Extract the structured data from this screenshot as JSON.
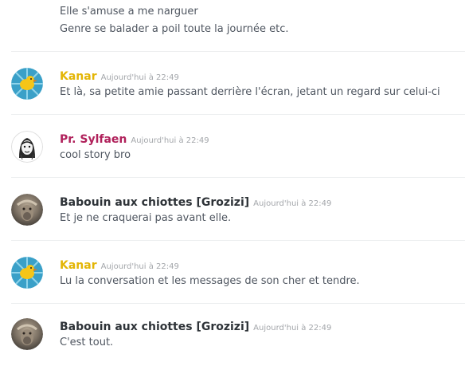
{
  "chat": {
    "continuation_lines": [
      "Elle s'amuse a me narguer",
      "Genre se balader a poil toute la journée etc."
    ],
    "messages": [
      {
        "username": "Kanar",
        "username_color": "#e3b505",
        "avatar_icon": "yellow-duck-sunburst-avatar",
        "timestamp": "Aujourd'hui à 22:49",
        "text": "Et là, sa petite amie passant derrière l'écran, jetant un regard sur celui-ci"
      },
      {
        "username": "Pr. Sylfaen",
        "username_color": "#b0215b",
        "avatar_icon": "sketch-portrait-avatar",
        "timestamp": "Aujourd'hui à 22:49",
        "text": "cool story bro"
      },
      {
        "username": "Babouin aux chiottes [Grozizi]",
        "username_color": "#2e3338",
        "avatar_icon": "baboon-photo-avatar",
        "timestamp": "Aujourd'hui à 22:49",
        "text": "Et je ne craquerai pas avant elle."
      },
      {
        "username": "Kanar",
        "username_color": "#e3b505",
        "avatar_icon": "yellow-duck-sunburst-avatar",
        "timestamp": "Aujourd'hui à 22:49",
        "text": "Lu la conversation et les messages de son cher et tendre."
      },
      {
        "username": "Babouin aux chiottes [Grozizi]",
        "username_color": "#2e3338",
        "avatar_icon": "baboon-photo-avatar",
        "timestamp": "Aujourd'hui à 22:49",
        "text": "C'est tout."
      }
    ]
  }
}
